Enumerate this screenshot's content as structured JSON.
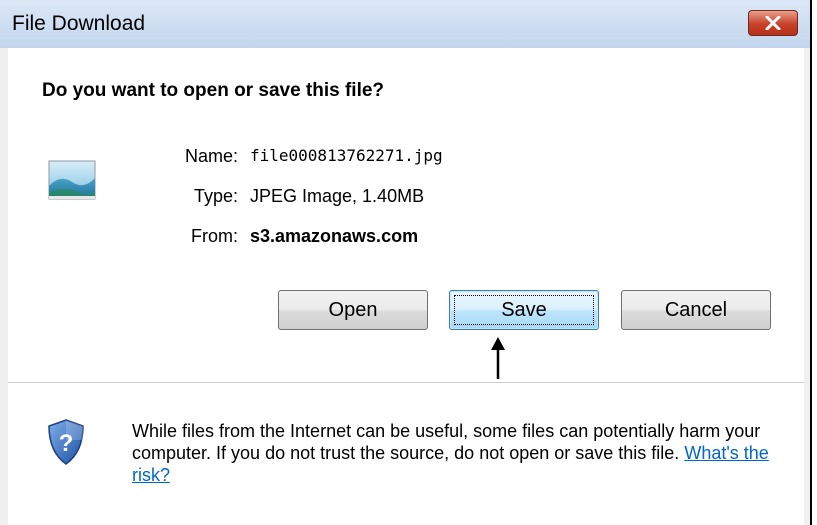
{
  "window": {
    "title": "File Download",
    "close_icon": "close-x-icon"
  },
  "dialog": {
    "question": "Do you want to open or save this file?",
    "file_icon": "image-file-icon",
    "name_label": "Name:",
    "name_value": "file000813762271.jpg",
    "type_label": "Type:",
    "type_value": "JPEG Image, 1.40MB",
    "from_label": "From:",
    "from_value": "s3.amazonaws.com"
  },
  "buttons": {
    "open": "Open",
    "save": "Save",
    "cancel": "Cancel",
    "default": "save"
  },
  "annotation": {
    "arrow_icon": "up-arrow-icon"
  },
  "warning": {
    "icon": "shield-question-icon",
    "text": "While files from the Internet can be useful, some files can potentially harm your computer. If you do not trust the source, do not open or save this file.",
    "link": "What's the risk?"
  },
  "colors": {
    "link": "#0066cc",
    "titlebar": "#c3d6ee",
    "close_button": "#c8412a",
    "default_button": "#bee6fd"
  }
}
